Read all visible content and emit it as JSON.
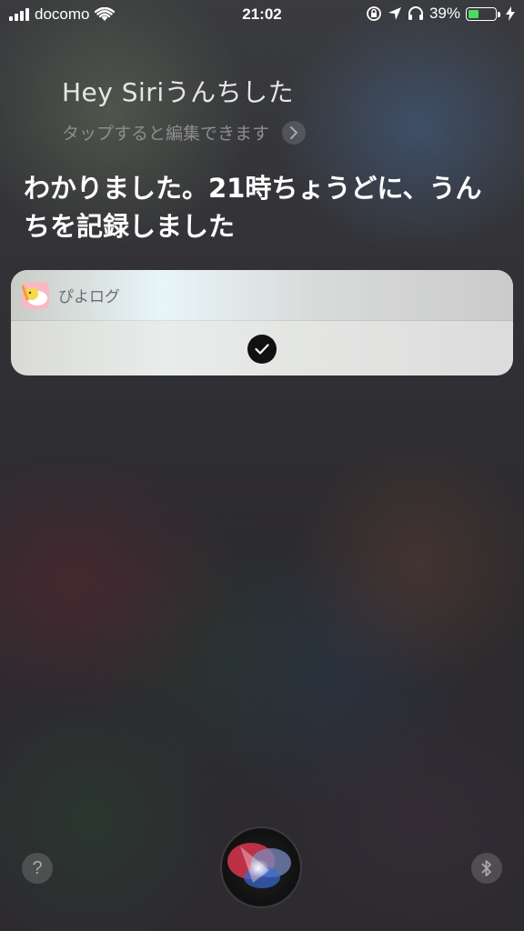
{
  "status_bar": {
    "carrier": "docomo",
    "time": "21:02",
    "battery_percent": "39%",
    "battery_level": 0.39,
    "icons": [
      "signal-icon",
      "wifi-icon",
      "rotation-lock-icon",
      "location-icon",
      "headphones-icon",
      "battery-icon",
      "charging-icon"
    ]
  },
  "siri": {
    "query": "Hey Siriうんちした",
    "edit_hint": "タップすると編集できます",
    "response": "わかりました。21時ちょうどに、うんちを記録しました"
  },
  "card": {
    "app_name": "ぴよログ",
    "status_icon": "checkmark-icon"
  },
  "controls": {
    "help_label": "?",
    "help_icon": "question-icon",
    "bluetooth_icon": "bluetooth-icon",
    "siri_orb": "siri-orb-icon"
  },
  "colors": {
    "battery_fill": "#4cd964",
    "card_background": "#e4e5e3"
  }
}
